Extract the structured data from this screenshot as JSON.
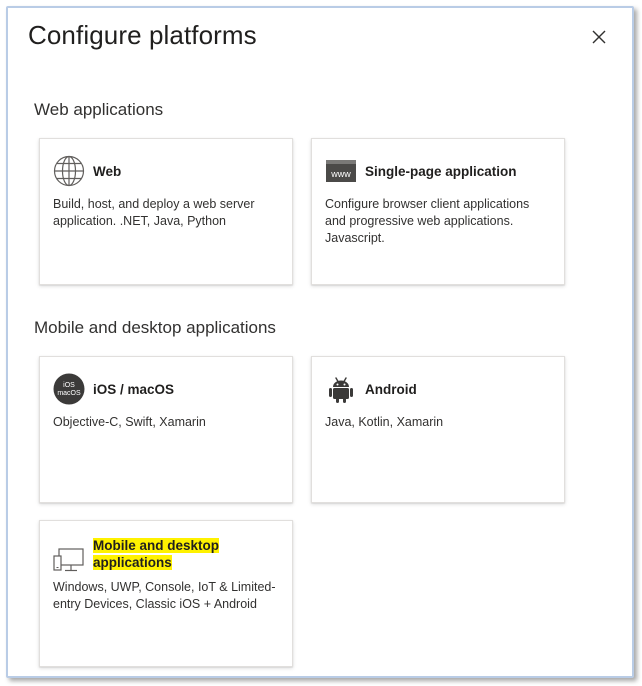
{
  "panel": {
    "title": "Configure platforms"
  },
  "sections": [
    {
      "header": "Web applications",
      "cards": [
        {
          "title": "Web",
          "description": "Build, host, and deploy a web server application. .NET, Java, Python",
          "icon": "globe-icon"
        },
        {
          "title": "Single-page application",
          "description": "Configure browser client applications and progressive web applications. Javascript.",
          "icon": "www-browser-icon",
          "icon_text": "www"
        }
      ]
    },
    {
      "header": "Mobile and desktop applications",
      "cards": [
        {
          "title": "iOS / macOS",
          "description": "Objective-C, Swift, Xamarin",
          "icon": "ios-macos-icon",
          "icon_text_1": "iOS",
          "icon_text_2": "macOS"
        },
        {
          "title": "Android",
          "description": "Java, Kotlin, Xamarin",
          "icon": "android-icon"
        },
        {
          "title": "Mobile and desktop applications",
          "description": "Windows, UWP, Console, IoT & Limited-entry Devices, Classic iOS + Android",
          "icon": "desktop-monitor-icon",
          "highlighted": true
        }
      ]
    }
  ],
  "colors": {
    "highlight": "#fff200",
    "frame_border": "#b9cce6",
    "card_border": "#e1dfdd"
  }
}
